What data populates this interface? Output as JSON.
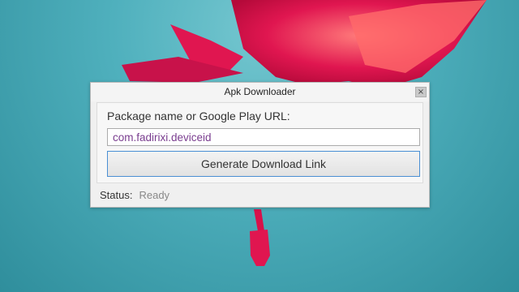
{
  "window": {
    "title": "Apk Downloader",
    "close_label": "×"
  },
  "form": {
    "prompt": "Package name or Google Play URL:",
    "input_value": "com.fadirixi.deviceid",
    "button_label": "Generate Download Link"
  },
  "status": {
    "label": "Status:",
    "value": "Ready"
  },
  "colors": {
    "wallpaper": "#4fb0bd",
    "flower": "#d8114a",
    "input_text": "#7a3d8f",
    "button_focus_border": "#4a8fd4"
  },
  "icons": {
    "close": "close-icon"
  }
}
